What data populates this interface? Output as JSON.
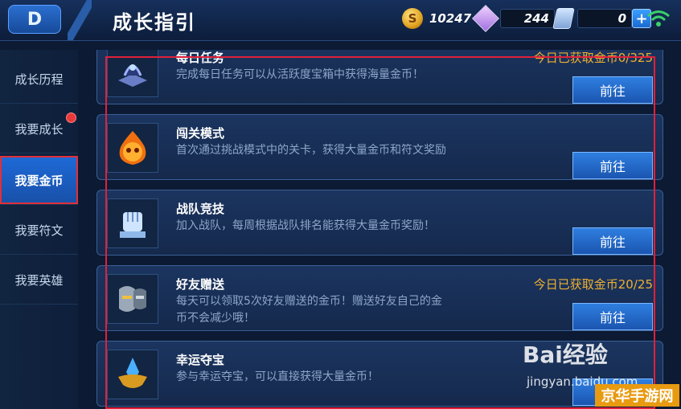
{
  "header": {
    "back_glyph": "D",
    "title": "成长指引",
    "gold": "10247",
    "diamonds": "244",
    "vouchers": "0",
    "plus": "+"
  },
  "sidebar": {
    "items": [
      {
        "label": "成长历程"
      },
      {
        "label": "我要成长"
      },
      {
        "label": "我要金币"
      },
      {
        "label": "我要符文"
      },
      {
        "label": "我要英雄"
      }
    ],
    "active": "我要金币"
  },
  "tasks": [
    {
      "title": "每日任务",
      "desc": "完成每日任务可以从活跃度宝箱中获得海量金币！",
      "extra": "今日已获取金币0/325",
      "button": "前往",
      "icon": "book-icon"
    },
    {
      "title": "闯关模式",
      "desc": "首次通过挑战模式中的关卡，获得大量金币和符文奖励",
      "extra": "",
      "button": "前往",
      "icon": "flame-skull-icon"
    },
    {
      "title": "战队竞技",
      "desc": "加入战队，每周根据战队排名能获得大量金币奖励！",
      "extra": "",
      "button": "前往",
      "icon": "fist-icon"
    },
    {
      "title": "好友赠送",
      "desc": "每天可以领取5次好友赠送的金币！赠送好友自己的金币不会减少哦！",
      "extra": "今日已获取金币20/25",
      "button": "前往",
      "icon": "helmets-icon"
    },
    {
      "title": "幸运夺宝",
      "desc": "参与幸运夺宝，可以直接获得大量金币！",
      "extra": "",
      "button": "前往",
      "icon": "crystal-icon"
    }
  ],
  "watermark": {
    "brand": "Bai经验",
    "url": "jingyan.baidu.com",
    "site": "京华手游网"
  },
  "colors": {
    "accent": "#1e6ad8",
    "highlight": "#e0203a",
    "gold_text": "#f0b030"
  }
}
